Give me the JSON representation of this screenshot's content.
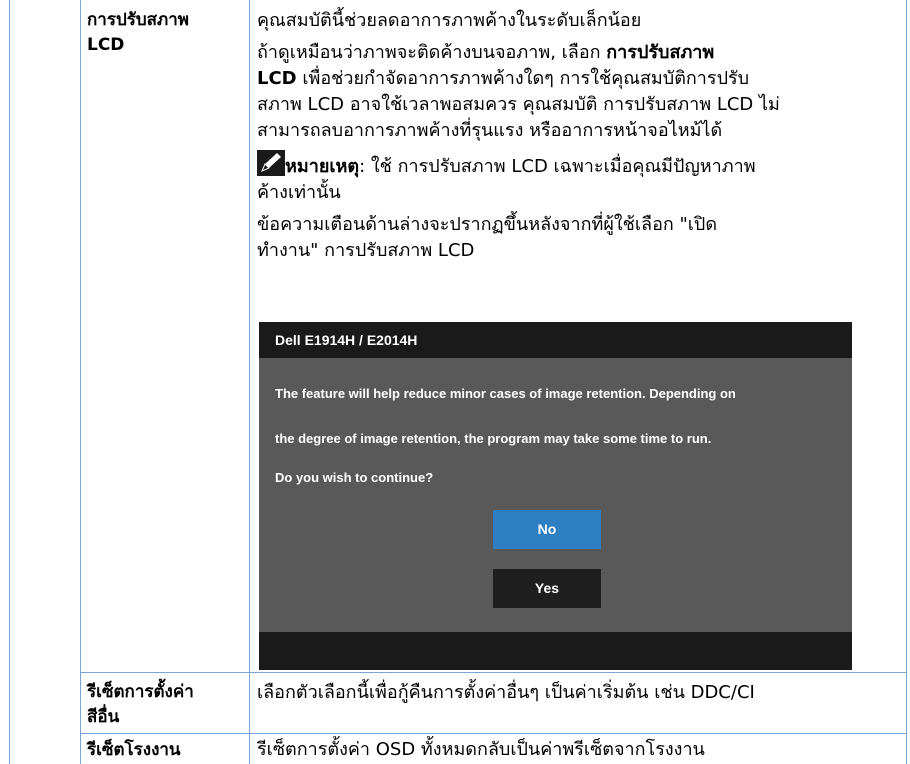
{
  "rows": [
    {
      "label_line1": "การปรับสภาพ",
      "label_line2": "LCD",
      "intro": "คุณสมบัตินี้ช่วยลดอาการภาพค้างในระดับเล็กน้อย",
      "para_l1_a": "ถ้าดูเหมือนว่าภาพจะติดค้างบนจอภาพ, เลือก ",
      "para_l1_b": "การปรับสภาพ",
      "para_l2_a": "LCD",
      "para_l2_b": " เพื่อช่วยกำจัดอาการภาพค้างใดๆ การใช้คุณสมบัติการปรับ",
      "para_l3": "สภาพ LCD อาจใช้เวลาพอสมควร คุณสมบัติ การปรับสภาพ LCD ไม่",
      "para_l4": "สามารถลบอาการภาพค้างที่รุนแรง หรืออาการหน้าจอไหม้ได้",
      "note_label": "หมายเหตุ",
      "note_l1": ": ใช้ การปรับสภาพ LCD เฉพาะเมื่อคุณมีปัญหาภาพ",
      "note_l2": "ค้างเท่านั้น",
      "warn_l1": "ข้อความเตือนด้านล่างจะปรากฏขึ้นหลังจากที่ผู้ใช้เลือก \"เปิด",
      "warn_l2": "ทำงาน\" การปรับสภาพ LCD"
    },
    {
      "label_line1": "รีเซ็ตการตั้งค่า",
      "label_line2": "สีอื่น",
      "text": "เลือกตัวเลือกนี้เพื่อกู้คืนการตั้งค่าอื่นๆ เป็นค่าเริ่มต้น เช่น DDC/CI"
    },
    {
      "label_line1": "รีเซ็ตโรงงาน",
      "text": "รีเซ็ตการตั้งค่า OSD ทั้งหมดกลับเป็นค่าพรีเซ็ตจากโรงงาน"
    }
  ],
  "dialog": {
    "title": "Dell E1914H / E2014H",
    "line1": "The feature will help reduce minor cases of image retention. Depending on",
    "line2": "the degree of image retention, the program may take some time to run.",
    "line3": "Do you wish to continue?",
    "no_label": "No",
    "yes_label": "Yes"
  },
  "icons": {
    "note": "pencil-icon"
  },
  "colors": {
    "table_border": "#7aa6d6",
    "dialog_bg": "#595959",
    "dialog_bar": "#1a1a1a",
    "no_button": "#2e7ec2",
    "yes_button": "#1f1f1f"
  }
}
